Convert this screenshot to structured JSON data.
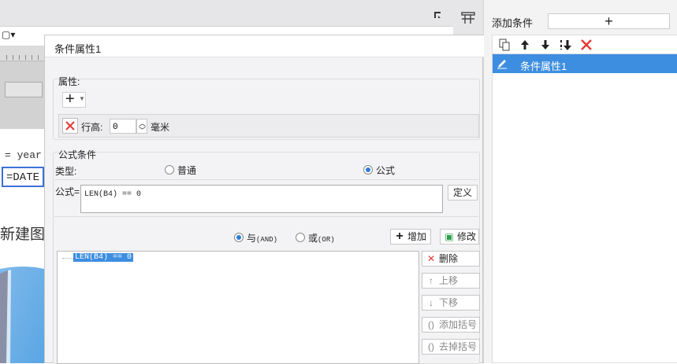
{
  "background": {
    "cell_text1": "= year",
    "cell_text2": "=DATE",
    "new_chart_text": "新建图表"
  },
  "right_panel": {
    "add_condition_label": "添加条件",
    "add_condition_button": "+",
    "toolbar_icons": [
      "copy-icon",
      "arrow-up-icon",
      "arrow-down-icon",
      "sort-down-icon",
      "delete-icon"
    ],
    "conditions": [
      {
        "label": "条件属性1",
        "selected": true
      }
    ]
  },
  "dialog": {
    "title": "条件属性1",
    "properties": {
      "group_title": "属性:",
      "add_button": "+",
      "row_height_label": "行高:",
      "row_height_value": "0",
      "row_height_unit": "毫米"
    },
    "formula_condition": {
      "group_title": "公式条件",
      "type_label": "类型:",
      "type_options": [
        "普通",
        "公式"
      ],
      "type_selected": "公式",
      "formula_label": "公式=",
      "formula_value": "LEN(B4) == 0",
      "define_button": "定义",
      "logic_and_label": "与",
      "logic_and_suffix": "(AND)",
      "logic_or_label": "或",
      "logic_or_suffix": "(OR)",
      "logic_selected": "AND",
      "add_button": "增加",
      "modify_button": "修改",
      "tree_nodes": [
        "LEN(B4) == 0"
      ],
      "delete_button": "删除",
      "move_up_button": "上移",
      "move_down_button": "下移",
      "add_bracket_button": "添加括号",
      "remove_bracket_button": "去掉括号"
    }
  },
  "colors": {
    "accent": "#3d8ee0",
    "delete_red": "#e53935",
    "modify_green": "#2e9e4b"
  }
}
